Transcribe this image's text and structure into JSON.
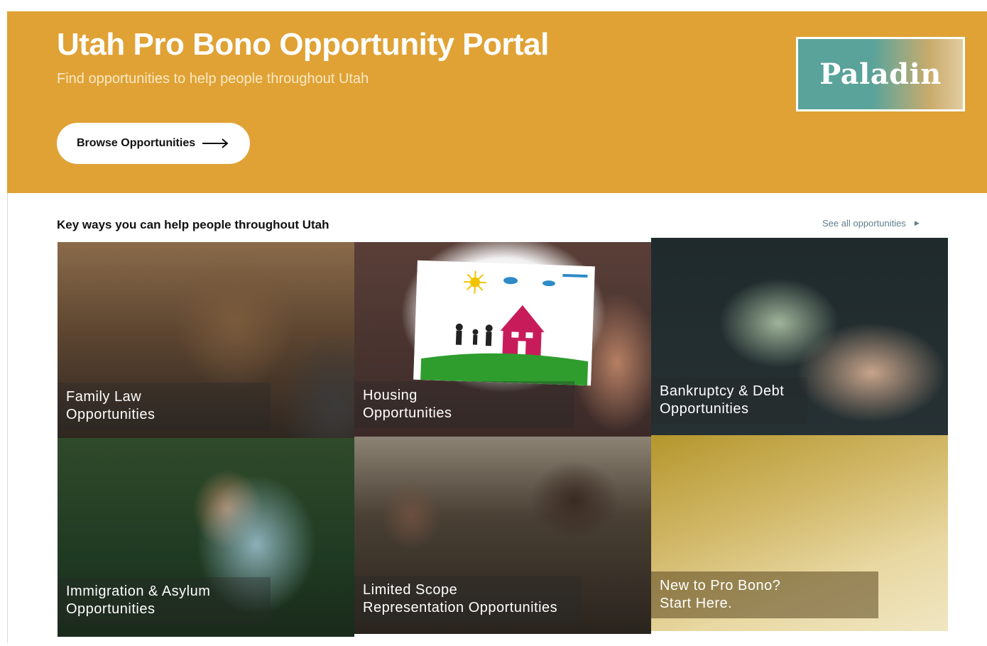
{
  "hero": {
    "title": "Utah Pro Bono Opportunity Portal",
    "subtitle": "Find opportunities to help people throughout Utah",
    "browse_button": "Browse Opportunities",
    "logo_text": "Paladin",
    "bg_color": "#e0a235"
  },
  "section": {
    "title": "Key ways you can help people throughout Utah",
    "see_all": "See all opportunities"
  },
  "tiles": [
    {
      "line1": "Family Law",
      "line2": "Opportunities"
    },
    {
      "line1": "Housing",
      "line2": "Opportunities"
    },
    {
      "line1": "Bankruptcy & Debt",
      "line2": "Opportunities"
    },
    {
      "line1": "Immigration & Asylum",
      "line2": "Opportunities"
    },
    {
      "line1": "Limited Scope",
      "line2": "Representation Opportunities"
    },
    {
      "line1": "New to Pro Bono?",
      "line2": "Start Here."
    }
  ],
  "icons": {
    "browse_arrow": "arrow-right-icon",
    "see_all_arrow": "triangle-right-icon"
  }
}
